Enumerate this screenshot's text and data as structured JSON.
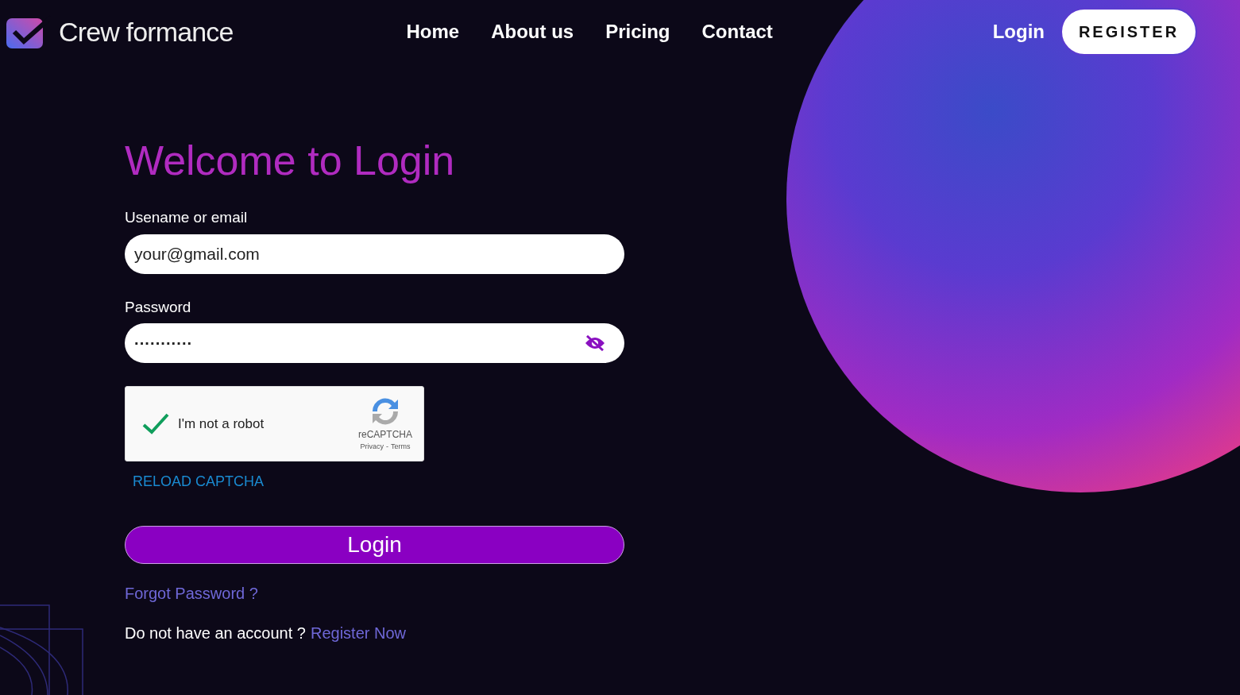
{
  "header": {
    "logo_text": "Crew formance",
    "nav": [
      {
        "label": "Home"
      },
      {
        "label": "About us"
      },
      {
        "label": "Pricing"
      },
      {
        "label": "Contact"
      }
    ],
    "login_link": "Login",
    "register_button": "REGISTER"
  },
  "form": {
    "title": "Welcome to Login",
    "username": {
      "label": "Usename or email",
      "value": "your@gmail.com"
    },
    "password": {
      "label": "Password",
      "value": "···········",
      "visible": false
    },
    "captcha": {
      "checked": true,
      "label": "I'm not a robot",
      "brand": "reCAPTCHA",
      "privacy": "Privacy",
      "separator": "-",
      "terms": "Terms"
    },
    "reload_captcha": "RELOAD CAPTCHA",
    "submit": "Login",
    "forgot": "Forgot Password ?",
    "no_account": "Do not have an account ?",
    "register_now": "Register Now"
  }
}
